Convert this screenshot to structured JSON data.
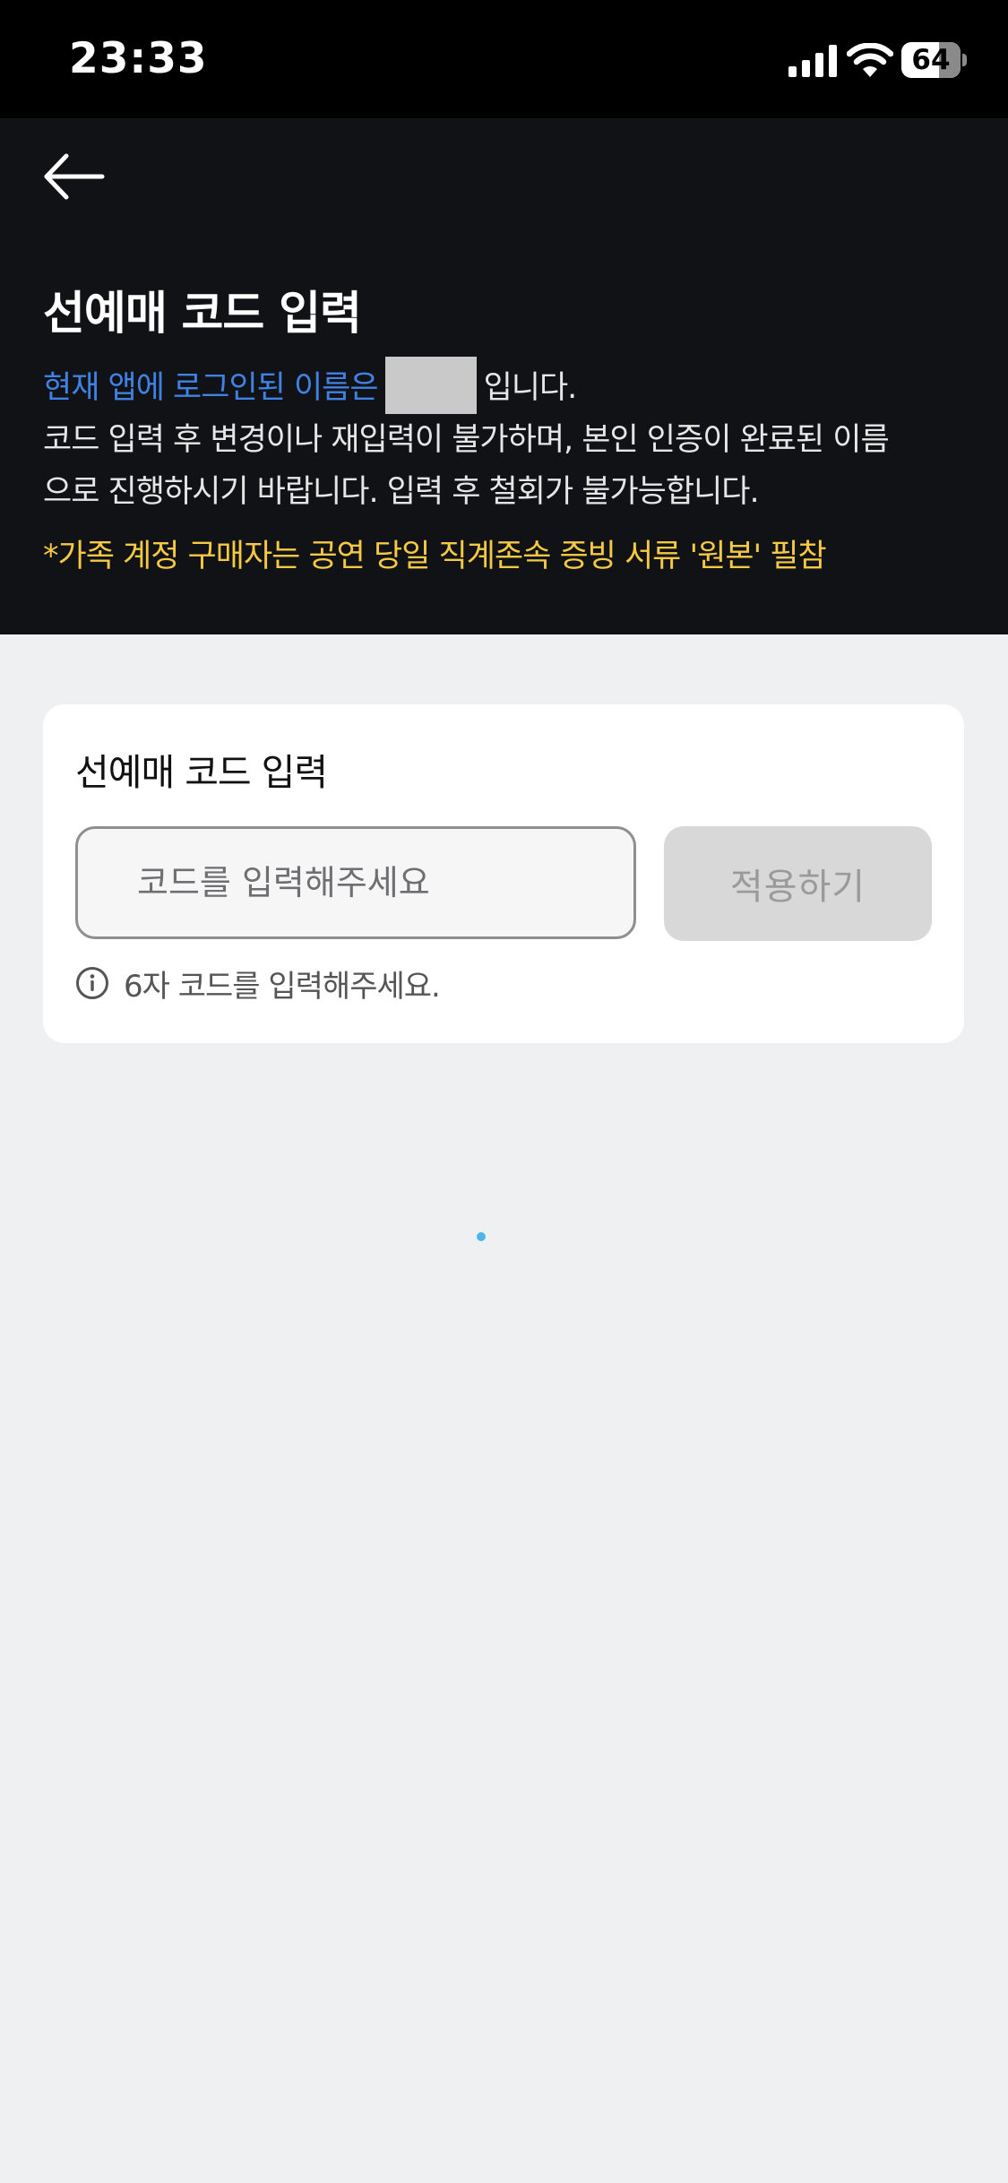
{
  "status_bar": {
    "time": "23:33",
    "battery_level": "64",
    "battery_fraction": 0.64
  },
  "header": {
    "back_icon": "arrow-left-icon",
    "title": "선예매 코드 입력",
    "login_prefix": "현재 앱에 로그인된 이름은",
    "login_suffix": "입니다.",
    "instruction_line1": "코드 입력 후 변경이나 재입력이 불가하며, 본인 인증이 완료된 이름",
    "instruction_line2": "으로 진행하시기 바랍니다. 입력 후 철회가 불가능합니다.",
    "family_notice": "*가족 계정 구매자는 공연 당일 직계존속 증빙 서류 '원본' 필참"
  },
  "card": {
    "title": "선예매 코드 입력",
    "code_input": {
      "placeholder": "코드를 입력해주세요",
      "value": ""
    },
    "apply_button": "적용하기",
    "hint_icon": "info-icon",
    "hint": "6자 코드를 입력해주세요."
  },
  "colors": {
    "header_bg": "#111215",
    "page_bg": "#eff0f2",
    "login_text": "#3f82e4",
    "notice_text": "#f5c944",
    "apply_disabled_bg": "#d8d8d8",
    "loading_dot": "#4cb6e8"
  }
}
